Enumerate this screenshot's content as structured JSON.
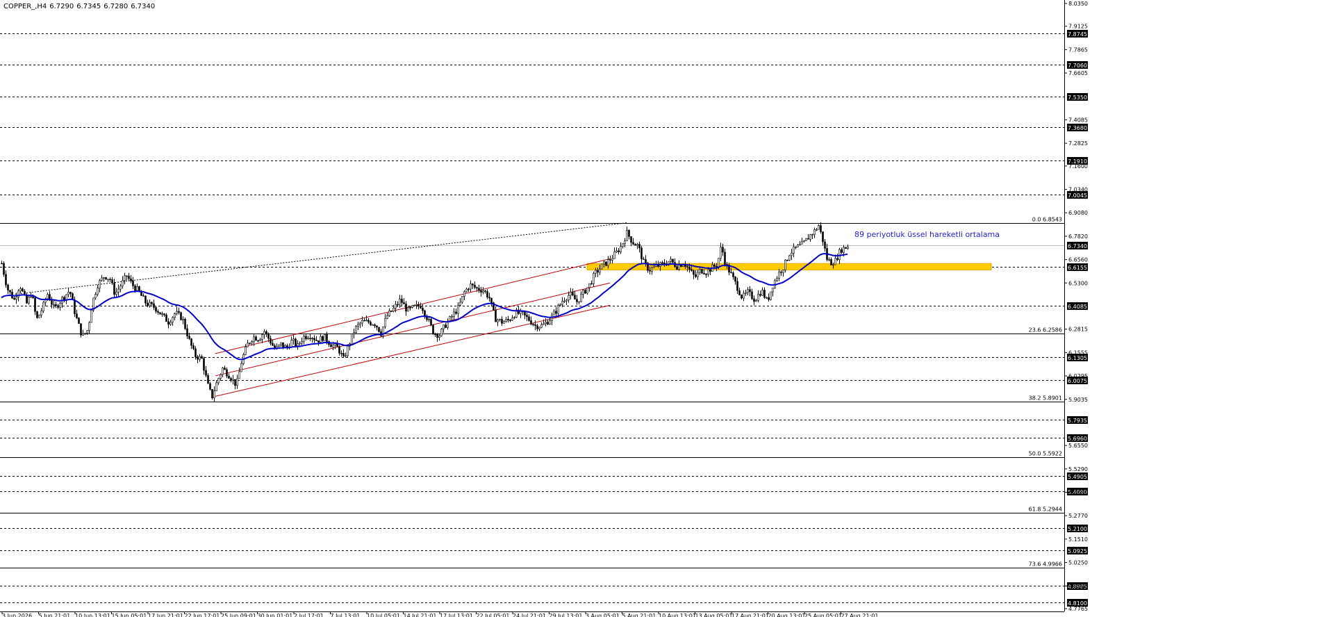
{
  "header": {
    "symbol": "COPPER_,H4",
    "open": "6.7290",
    "high": "6.7345",
    "low": "6.7280",
    "close": "6.7340"
  },
  "colors": {
    "background": "#ffffff",
    "foreground": "#000000",
    "candle": "#000000",
    "ema": "#0000cc",
    "channel": "#c00000",
    "zone": "#ffcc00",
    "zone_border": "#e6a800",
    "annotation": "#1f1fcf"
  },
  "chart_data": {
    "type": "candlestick",
    "symbol": "COPPER_",
    "timeframe": "H4",
    "ylim": [
      4.7765,
      8.035
    ],
    "grid": false,
    "price_scale_ticks": [
      "8.0350",
      "7.9125",
      "7.7865",
      "7.6605",
      "7.4085",
      "7.2825",
      "7.1600",
      "7.0340",
      "6.9080",
      "6.7820",
      "6.6560",
      "6.5300",
      "6.2815",
      "6.1555",
      "6.0295",
      "5.9035",
      "5.6550",
      "5.5290",
      "5.4030",
      "5.2770",
      "5.1510",
      "5.0250",
      "4.8990",
      "4.7765"
    ],
    "x_ticks": [
      "3 Jun 2026",
      "5 Jun 21:01",
      "10 Jun 13:01",
      "15 Jun 05:01",
      "17 Jun 21:01",
      "22 Jun 17:01",
      "25 Jun 09:01",
      "30 Jun 01:01",
      "2 Jul 17:01",
      "7 Jul 13:01",
      "10 Jul 05:01",
      "14 Jul 21:01",
      "17 Jul 13:01",
      "22 Jul 05:01",
      "24 Jul 21:01",
      "29 Jul 13:01",
      "3 Aug 05:01",
      "5 Aug 21:01",
      "10 Aug 13:01",
      "13 Aug 05:01",
      "17 Aug 21:01",
      "20 Aug 13:01",
      "25 Aug 05:01",
      "27 Aug 21:01"
    ],
    "current_price": "6.7340",
    "horizontal_levels": [
      {
        "label": "7.8745",
        "value": 7.8745
      },
      {
        "label": "7.7060",
        "value": 7.706
      },
      {
        "label": "7.5350",
        "value": 7.535
      },
      {
        "label": "7.3680",
        "value": 7.368
      },
      {
        "label": "7.1910",
        "value": 7.191
      },
      {
        "label": "7.0045",
        "value": 7.0045
      },
      {
        "label": "6.6155",
        "value": 6.6155
      },
      {
        "label": "6.4085",
        "value": 6.4085
      },
      {
        "label": "6.1305",
        "value": 6.1305
      },
      {
        "label": "6.0075",
        "value": 6.0075
      },
      {
        "label": "5.7935",
        "value": 5.7935
      },
      {
        "label": "5.6960",
        "value": 5.696
      },
      {
        "label": "5.4905",
        "value": 5.4905
      },
      {
        "label": "5.4090",
        "value": 5.409
      },
      {
        "label": "5.2100",
        "value": 5.21
      },
      {
        "label": "5.0925",
        "value": 5.0925
      },
      {
        "label": "4.8985",
        "value": 4.8985
      },
      {
        "label": "4.8100",
        "value": 4.81
      }
    ],
    "fibonacci_levels": [
      {
        "label": "0.0 6.8543",
        "value": 6.8543
      },
      {
        "label": "23.6 6.2586",
        "value": 6.2586
      },
      {
        "label": "38.2 5.8901",
        "value": 5.8901
      },
      {
        "label": "50.0 5.5922",
        "value": 5.5922
      },
      {
        "label": "61.8 5.2944",
        "value": 5.2944
      },
      {
        "label": "73.6 4.9966",
        "value": 4.9966
      }
    ],
    "support_zone": {
      "low": 6.6,
      "high": 6.635
    },
    "annotation": "89 periyotluk üssel hareketli ortalama",
    "price_waypoints": [
      [
        0,
        6.67
      ],
      [
        10,
        6.5
      ],
      [
        20,
        6.44
      ],
      [
        28,
        6.52
      ],
      [
        38,
        6.42
      ],
      [
        45,
        6.48
      ],
      [
        52,
        6.33
      ],
      [
        60,
        6.39
      ],
      [
        68,
        6.47
      ],
      [
        78,
        6.39
      ],
      [
        90,
        6.45
      ],
      [
        100,
        6.49
      ],
      [
        108,
        6.36
      ],
      [
        118,
        6.24
      ],
      [
        126,
        6.28
      ],
      [
        132,
        6.42
      ],
      [
        140,
        6.52
      ],
      [
        150,
        6.57
      ],
      [
        158,
        6.55
      ],
      [
        165,
        6.47
      ],
      [
        172,
        6.51
      ],
      [
        182,
        6.57
      ],
      [
        190,
        6.52
      ],
      [
        198,
        6.49
      ],
      [
        210,
        6.42
      ],
      [
        222,
        6.4
      ],
      [
        232,
        6.36
      ],
      [
        242,
        6.32
      ],
      [
        252,
        6.37
      ],
      [
        262,
        6.34
      ],
      [
        272,
        6.22
      ],
      [
        280,
        6.14
      ],
      [
        290,
        6.12
      ],
      [
        300,
        5.96
      ],
      [
        305,
        5.92
      ],
      [
        312,
        6.0
      ],
      [
        320,
        6.07
      ],
      [
        330,
        6.03
      ],
      [
        340,
        5.98
      ],
      [
        348,
        6.12
      ],
      [
        356,
        6.2
      ],
      [
        364,
        6.24
      ],
      [
        372,
        6.23
      ],
      [
        380,
        6.27
      ],
      [
        388,
        6.22
      ],
      [
        396,
        6.17
      ],
      [
        404,
        6.2
      ],
      [
        412,
        6.18
      ],
      [
        420,
        6.22
      ],
      [
        428,
        6.19
      ],
      [
        436,
        6.24
      ],
      [
        446,
        6.25
      ],
      [
        456,
        6.22
      ],
      [
        466,
        6.24
      ],
      [
        476,
        6.2
      ],
      [
        486,
        6.18
      ],
      [
        494,
        6.12
      ],
      [
        502,
        6.2
      ],
      [
        510,
        6.28
      ],
      [
        520,
        6.32
      ],
      [
        530,
        6.32
      ],
      [
        540,
        6.31
      ],
      [
        548,
        6.26
      ],
      [
        556,
        6.35
      ],
      [
        566,
        6.39
      ],
      [
        576,
        6.44
      ],
      [
        586,
        6.38
      ],
      [
        596,
        6.4
      ],
      [
        606,
        6.41
      ],
      [
        616,
        6.33
      ],
      [
        624,
        6.26
      ],
      [
        632,
        6.25
      ],
      [
        640,
        6.3
      ],
      [
        650,
        6.35
      ],
      [
        660,
        6.4
      ],
      [
        668,
        6.48
      ],
      [
        676,
        6.52
      ],
      [
        686,
        6.5
      ],
      [
        696,
        6.49
      ],
      [
        704,
        6.45
      ],
      [
        712,
        6.34
      ],
      [
        722,
        6.32
      ],
      [
        732,
        6.33
      ],
      [
        742,
        6.37
      ],
      [
        752,
        6.36
      ],
      [
        762,
        6.33
      ],
      [
        770,
        6.3
      ],
      [
        780,
        6.3
      ],
      [
        790,
        6.33
      ],
      [
        800,
        6.38
      ],
      [
        810,
        6.44
      ],
      [
        820,
        6.47
      ],
      [
        830,
        6.43
      ],
      [
        840,
        6.48
      ],
      [
        848,
        6.52
      ],
      [
        856,
        6.58
      ],
      [
        866,
        6.62
      ],
      [
        876,
        6.65
      ],
      [
        886,
        6.69
      ],
      [
        894,
        6.73
      ],
      [
        902,
        6.8
      ],
      [
        910,
        6.75
      ],
      [
        918,
        6.73
      ],
      [
        926,
        6.64
      ],
      [
        934,
        6.6
      ],
      [
        944,
        6.62
      ],
      [
        954,
        6.63
      ],
      [
        964,
        6.65
      ],
      [
        974,
        6.62
      ],
      [
        984,
        6.64
      ],
      [
        992,
        6.6
      ],
      [
        1000,
        6.56
      ],
      [
        1008,
        6.6
      ],
      [
        1016,
        6.59
      ],
      [
        1024,
        6.61
      ],
      [
        1032,
        6.63
      ],
      [
        1038,
        6.73
      ],
      [
        1044,
        6.63
      ],
      [
        1050,
        6.59
      ],
      [
        1058,
        6.53
      ],
      [
        1068,
        6.45
      ],
      [
        1076,
        6.48
      ],
      [
        1086,
        6.44
      ],
      [
        1096,
        6.49
      ],
      [
        1104,
        6.43
      ],
      [
        1112,
        6.52
      ],
      [
        1120,
        6.58
      ],
      [
        1128,
        6.62
      ],
      [
        1136,
        6.69
      ],
      [
        1146,
        6.72
      ],
      [
        1156,
        6.74
      ],
      [
        1164,
        6.78
      ],
      [
        1172,
        6.81
      ],
      [
        1178,
        6.84
      ],
      [
        1184,
        6.76
      ],
      [
        1190,
        6.66
      ],
      [
        1196,
        6.64
      ],
      [
        1202,
        6.65
      ],
      [
        1210,
        6.71
      ],
      [
        1216,
        6.72
      ],
      [
        1222,
        6.734
      ]
    ]
  }
}
